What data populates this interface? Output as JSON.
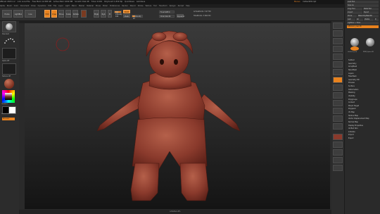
{
  "titlebar": {
    "items": [
      "ZBrush 2023.1.2",
      "Link Local File",
      "Free Mem 12.958 GB",
      "Active Mem 1092 MB",
      "Scratch Disk 48",
      "Timer 0.001",
      "PolyCount 1.832 Mp",
      "QuickSave",
      "AutoSave"
    ],
    "right": [
      "Menus",
      "DefaultZScript"
    ],
    "quicksave": "QuickSave"
  },
  "menubar": {
    "items": [
      "Alpha",
      "Brush",
      "Color",
      "Document",
      "Draw",
      "Dynamics",
      "Edit",
      "File",
      "Layer",
      "Light",
      "Macro",
      "Marker",
      "Material",
      "Movie",
      "Picker",
      "Preferences",
      "Render",
      "Stencil",
      "Stroke",
      "Texture",
      "Tool",
      "Transform",
      "Zplugin",
      "Zscript",
      "Help"
    ]
  },
  "toolbar": {
    "home_page": "Home Page",
    "lightbox": "LightBox",
    "live_boolean": "Live Boolean",
    "edit": "Edit",
    "draw": "Draw",
    "move": "Move",
    "scale": "Scale",
    "rotate": "Rotate",
    "mrgb": "Mrgb",
    "rgb": "Rgb",
    "m": "M",
    "zadd": "Zadd",
    "zsub": "Zsub",
    "rgb_intensity": "Rgb Intensity 100",
    "z_intensity": "Z Intensity 25",
    "focal_shift": "Focal Shift 0",
    "draw_size": "Draw Size 64",
    "dynamic": "Dynamic",
    "active_points": "ActivePoints: 3.27 Mil",
    "total_points": "TotalPoints: 3.664 Mil",
    "rgb_intensity_level": 1.0,
    "z_intensity_level": 0.25
  },
  "left": {
    "standard": "Standard",
    "dots": "Dots",
    "alpha_off": "Alpha Off",
    "texture_off": "Texture Off",
    "gradient": "Gradient",
    "switch_color": "SwitchColor",
    "alternate": "Alternate"
  },
  "rightpanel": {
    "tb_items": [
      "Load Tool",
      "Save As",
      "Copy Tool",
      "Paste Tool",
      "Import",
      "Export",
      "Clone",
      "Make PolyMesh3D",
      "GoZ",
      "All",
      "Visible",
      "R",
      "Lightbox > Tools",
      "Littlehero_new 48"
    ],
    "subtools": [
      "Littlehero_new",
      "PM3D_Sphere3D"
    ],
    "menu": [
      "Subtool",
      "Geometry",
      "ArrayMesh",
      "NanoMesh",
      "Layers",
      "FiberMesh",
      "Geometry HD",
      "Preview",
      "Surface",
      "Deformation",
      "Masking",
      "Visibility",
      "Polygroups",
      "Contact",
      "Morph Target",
      "Polypaint",
      "UV Map",
      "Texture Map",
      "Vector Displacement Map",
      "Normal Map",
      "Display Properties",
      "Unified Skin",
      "Initialize",
      "Import",
      "Export"
    ]
  },
  "statusbar": "LittleHero.ZTL",
  "colors": {
    "accent": "#e8821e",
    "figure": "#8a3a2c"
  }
}
